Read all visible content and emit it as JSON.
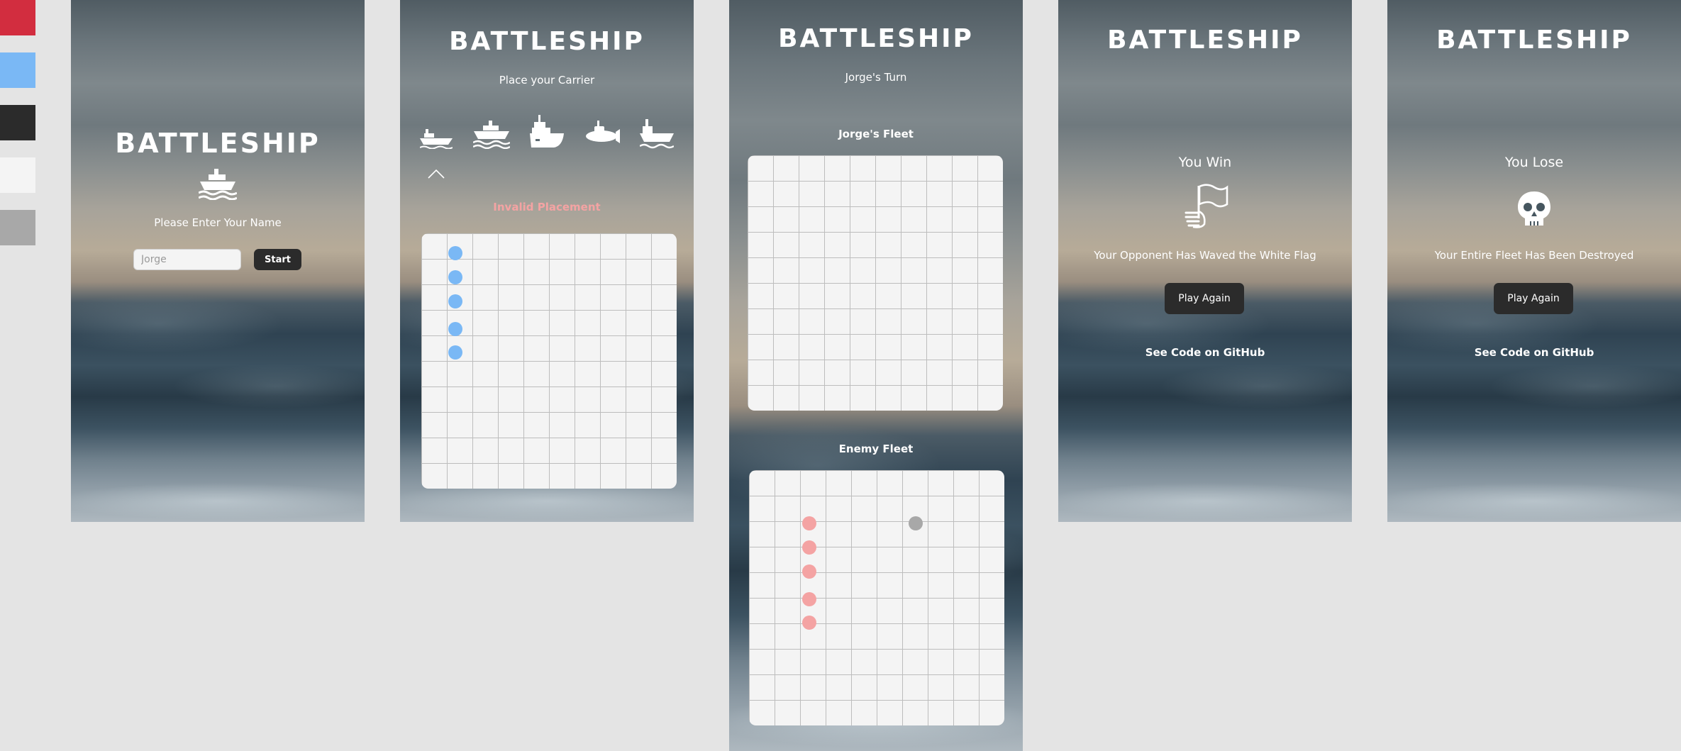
{
  "palette": {
    "red": "#d22d3f",
    "blue": "#7ab8f5",
    "dark": "#2b2b2b",
    "light": "#f4f4f4",
    "gray": "#a8a8a8"
  },
  "screen1": {
    "title": "BATTLESHIP",
    "icon": "ship-icon",
    "prompt": "Please Enter Your Name",
    "name_placeholder": "Jorge",
    "start_label": "Start"
  },
  "screen2": {
    "title": "BATTLESHIP",
    "subtitle": "Place your Carrier",
    "ships": [
      "carrier-icon",
      "battleship-icon",
      "destroyer-icon",
      "submarine-icon",
      "patrol-boat-icon"
    ],
    "selected_indicator": "chevron-up-icon",
    "error": "Invalid Placement",
    "placed_color": "#7ab8f5"
  },
  "screen3": {
    "title": "BATTLESHIP",
    "turn": "Jorge's Turn",
    "player_fleet_label": "Jorge's Fleet",
    "enemy_fleet_label": "Enemy Fleet",
    "hit_color": "#f4a3a3",
    "miss_color": "#a8a8a8"
  },
  "screen4": {
    "title": "BATTLESHIP",
    "result": "You Win",
    "icon": "white-flag-icon",
    "message": "Your Opponent Has Waved the White Flag",
    "play_again": "Play Again",
    "github": "See Code on GitHub"
  },
  "screen5": {
    "title": "BATTLESHIP",
    "result": "You Lose",
    "icon": "skull-icon",
    "message": "Your Entire Fleet Has Been Destroyed",
    "play_again": "Play Again",
    "github": "See Code on GitHub"
  }
}
